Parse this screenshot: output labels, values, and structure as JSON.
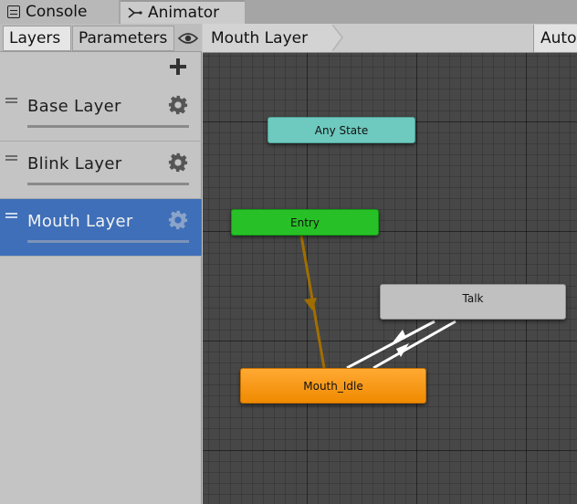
{
  "window_tabs": [
    {
      "label": "Console",
      "icon": "console-icon"
    },
    {
      "label": "Animator",
      "icon": "animator-icon"
    }
  ],
  "left_panel": {
    "tabs": [
      {
        "label": "Layers"
      },
      {
        "label": "Parameters"
      }
    ],
    "visibility_icon": "eye-icon",
    "add_icon": "plus-icon",
    "layers": [
      {
        "name": "Base Layer",
        "selected": false
      },
      {
        "name": "Blink Layer",
        "selected": false
      },
      {
        "name": "Mouth Layer",
        "selected": true
      }
    ]
  },
  "graph": {
    "breadcrumb": "Mouth Layer",
    "auto_button": "Auto",
    "states": {
      "any_state": "Any State",
      "entry": "Entry",
      "talk": "Talk",
      "mouth_idle": "Mouth_Idle"
    },
    "colors": {
      "background": "#474747",
      "any_state": "#6ec9be",
      "entry": "#27c127",
      "default_state": "#f59200",
      "state": "#c0c0c0",
      "entry_transition": "#a06e00",
      "transition": "#ffffff",
      "selected_layer": "#3e6fb8"
    }
  }
}
